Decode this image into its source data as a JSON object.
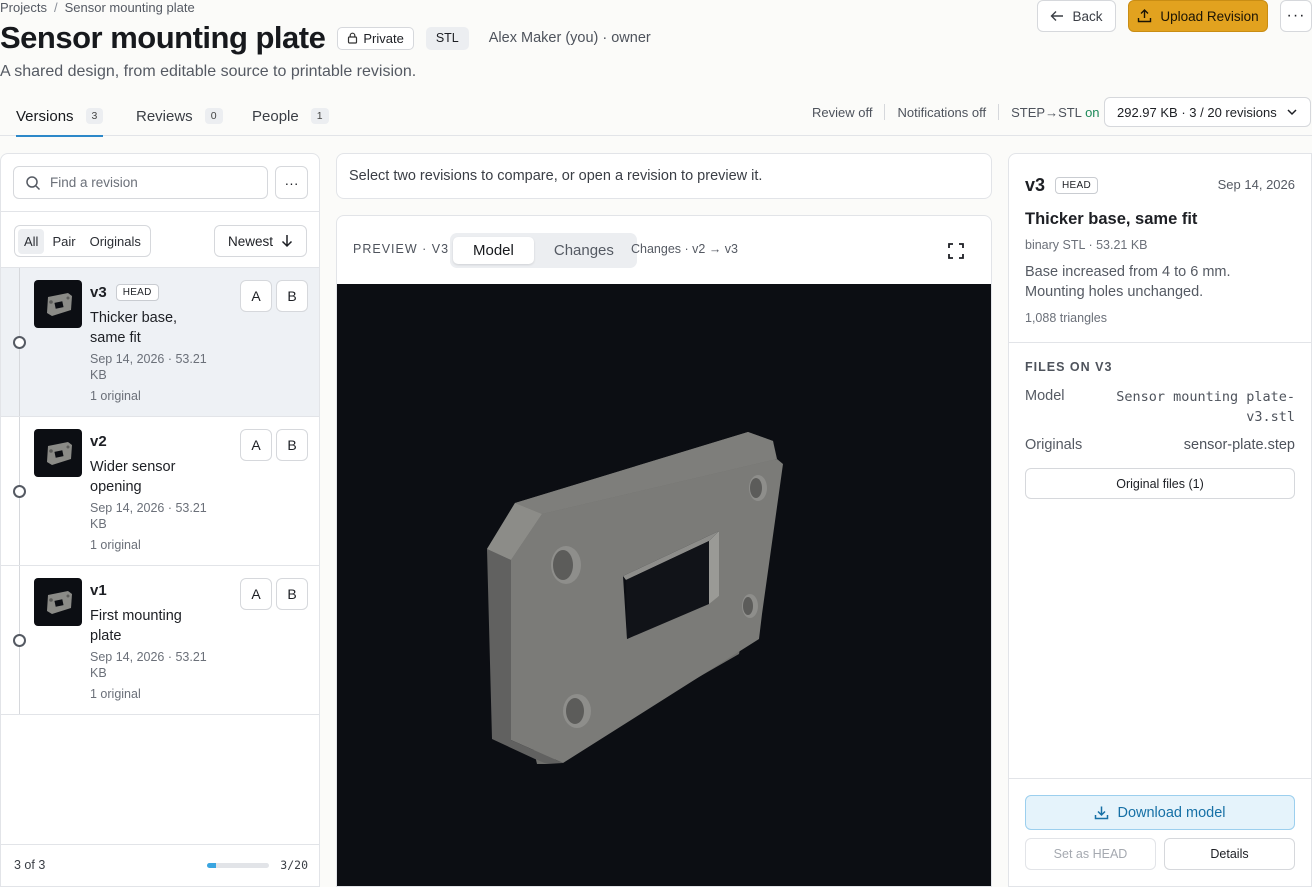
{
  "breadcrumb": {
    "root": "Projects",
    "separator": "/",
    "current": "Sensor mounting plate"
  },
  "header": {
    "title": "Sensor mounting plate",
    "visibility": "Private",
    "format": "STL",
    "owner": "Alex Maker (you) · owner",
    "subtitle": "A shared design, from editable source to printable revision.",
    "back_label": "Back",
    "upload_label": "Upload Revision",
    "more_label": "···"
  },
  "tabs": [
    {
      "label": "Versions",
      "count": "3"
    },
    {
      "label": "Reviews",
      "count": "0"
    },
    {
      "label": "People",
      "count": "1"
    }
  ],
  "settings": {
    "review": "Review off",
    "notifications": "Notifications off",
    "conversion_label": "STEP→STL",
    "conversion_state": "on",
    "quota": "292.97 KB · 3 / 20 revisions"
  },
  "sidebar": {
    "search_placeholder": "Find a revision",
    "filters": [
      "All",
      "Pair",
      "Originals"
    ],
    "sort_label": "Newest",
    "revisions": [
      {
        "name": "v3",
        "badge": "HEAD",
        "title": "Thicker base, same fit",
        "meta": "Sep 14, 2026 · 53.21 KB",
        "originals": "1 original"
      },
      {
        "name": "v2",
        "badge": "",
        "title": "Wider sensor opening",
        "meta": "Sep 14, 2026 · 53.21 KB",
        "originals": "1 original"
      },
      {
        "name": "v1",
        "badge": "",
        "title": "First mounting plate",
        "meta": "Sep 14, 2026 · 53.21 KB",
        "originals": "1 original"
      }
    ],
    "ab_labels": [
      "A",
      "B"
    ],
    "footer_left": "3 of 3",
    "footer_right": "3/20",
    "usage_fraction": 0.15
  },
  "main": {
    "hint": "Select two revisions to compare, or open a revision to preview it.",
    "preview_label": "PREVIEW · V3",
    "modes": [
      "Model",
      "Changes"
    ],
    "changes_label": "Changes · v2 → v3"
  },
  "details": {
    "version": "v3",
    "badge": "HEAD",
    "date": "Sep 14, 2026",
    "title": "Thicker base, same fit",
    "meta": "binary STL · 53.21 KB",
    "description": "Base increased from 4 to 6 mm. Mounting holes unchanged.",
    "triangles": "1,088 triangles",
    "files_heading": "FILES ON V3",
    "model_key": "Model",
    "model_value": "Sensor mounting plate-v3.stl",
    "originals_key": "Originals",
    "originals_value": "sensor-plate.step",
    "original_files_btn": "Original files (1)",
    "download_label": "Download model",
    "set_head_label": "Set as HEAD",
    "details_label": "Details"
  },
  "colors": {
    "accent": "#2d88c9",
    "upload": "#e2a21f",
    "viewport": "#0c0e13",
    "on": "#1e8a5a"
  }
}
